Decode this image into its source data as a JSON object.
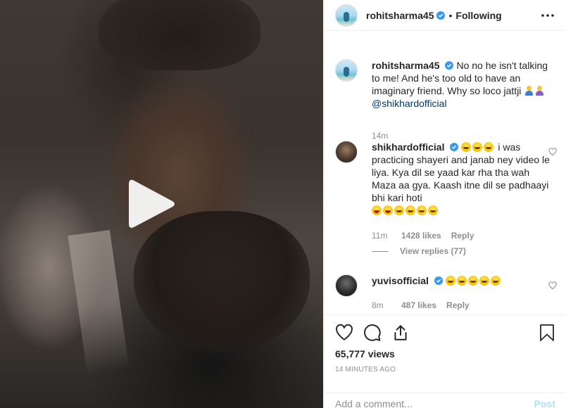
{
  "post": {
    "author": "rohitsharma45",
    "follow_status": "Following",
    "separator": "•",
    "caption": {
      "username": "rohitsharma45",
      "text": "No no he isn't talking to me! And he's too old to have an imaginary friend. Why so loco jattji",
      "mention": "@shikhardofficial",
      "time": "14m"
    }
  },
  "comments": [
    {
      "username": "shikhardofficial",
      "text": "i was practicing shayeri and janab ney video le liya. Kya dil se yaad kar rha tha wah Maza aa gya. Kaash itne dil se padhaayi bhi kari hoti",
      "time": "11m",
      "likes": "1428 likes",
      "reply": "Reply",
      "view_replies": "View replies (77)"
    },
    {
      "username": "yuvisofficial",
      "text": "",
      "time": "8m",
      "likes": "487 likes",
      "reply": "Reply"
    }
  ],
  "stats": {
    "views": "65,777 views",
    "posted": "14 MINUTES AGO"
  },
  "composer": {
    "placeholder": "Add a comment...",
    "post_label": "Post"
  },
  "icons": {
    "verified": "verified-badge-icon",
    "more": "more-options-icon",
    "play": "play-icon",
    "like": "heart-icon",
    "comment": "comment-icon",
    "share": "share-icon",
    "save": "bookmark-icon"
  },
  "colors": {
    "verified_blue": "#3897f0",
    "link": "#00376b",
    "muted": "#8e8e8e",
    "post_disabled": "#b2dffc"
  }
}
